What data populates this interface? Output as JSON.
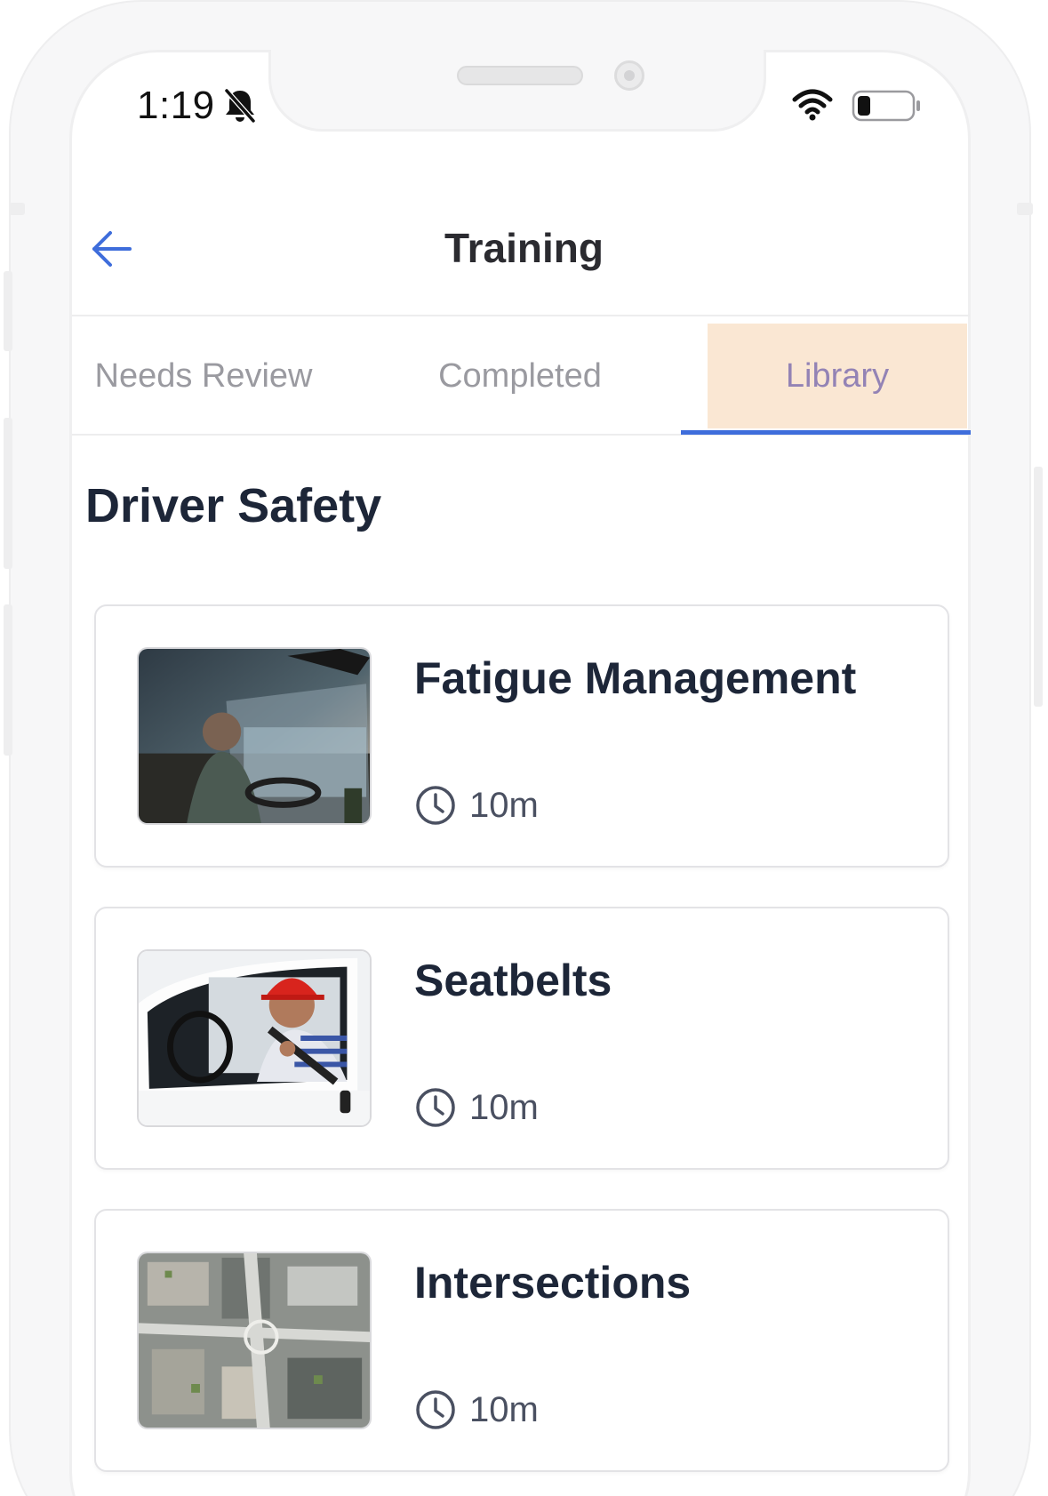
{
  "status_bar": {
    "time": "1:19",
    "icons": [
      "bell-slash-icon",
      "wifi-icon",
      "battery-icon"
    ]
  },
  "header": {
    "title": "Training",
    "back_icon": "arrow-left-icon",
    "accent_color": "#3e6ddb"
  },
  "tabs": [
    {
      "label": "Needs Review",
      "selected": false
    },
    {
      "label": "Completed",
      "selected": false
    },
    {
      "label": "Library",
      "selected": true
    }
  ],
  "section": {
    "title": "Driver Safety"
  },
  "courses": [
    {
      "title": "Fatigue Management",
      "duration": "10m",
      "image": "driver-in-truck-photo"
    },
    {
      "title": "Seatbelts",
      "duration": "10m",
      "image": "worker-with-seatbelt-photo"
    },
    {
      "title": "Intersections",
      "duration": "10m",
      "image": "aerial-city-intersection-photo"
    }
  ],
  "colors": {
    "title_text": "#1d2638",
    "tab_inactive": "#9a9aa0",
    "tab_selected_text": "#9383b5",
    "tab_selected_bg": "#fae7d3"
  }
}
